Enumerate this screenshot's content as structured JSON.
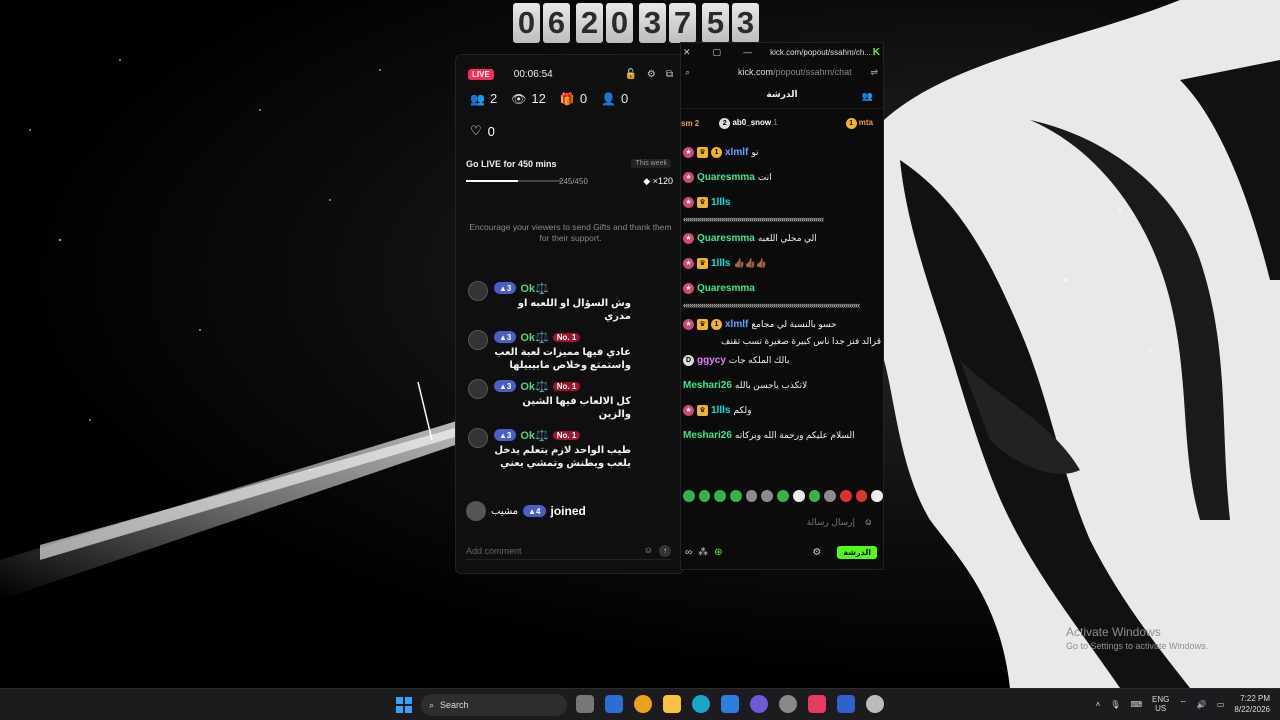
{
  "clock": {
    "digits": [
      "0",
      "6",
      "2",
      "0",
      "3",
      "7",
      "5",
      "3"
    ]
  },
  "dashboard": {
    "live_label": "LIVE",
    "duration": "00:06:54",
    "stats": {
      "viewers_now": "2",
      "views": "12",
      "gifts": "0",
      "new_followers": "0",
      "likes": "0"
    },
    "goal": {
      "title": "Go LIVE for 450 mins",
      "progress_text": "245/450",
      "progress_fraction": 0.544,
      "period": "This week",
      "reward": "×120"
    },
    "encourage_text": "Encourage your viewers to send Gifts and thank them for their support.",
    "messages": [
      {
        "level": "3",
        "user": "Ok⚖️",
        "badge": "",
        "text": "وش السؤال او اللعبه او مدري"
      },
      {
        "level": "3",
        "user": "Ok⚖️",
        "badge": "No. 1",
        "text": "عادي فيها مميزات لعبة العب واستمتع وخلاص مابيبيلها"
      },
      {
        "level": "3",
        "user": "Ok⚖️",
        "badge": "No. 1",
        "text": "كل الالعاب فيها الشين والزين"
      },
      {
        "level": "3",
        "user": "Ok⚖️",
        "badge": "No. 1",
        "text": "طيب الواحد لازم يتعلم يدخل يلعب ويطنش وتمشي يعني"
      }
    ],
    "joined": {
      "user": "مشيب",
      "level": "4",
      "word": "joined"
    },
    "comment_placeholder": "Add comment"
  },
  "kick": {
    "window_url": "kick.com/popout/ssahm/ch...",
    "address_domain": "kick.com",
    "address_path": "/popout/ssahm/chat",
    "header_title": "الدرشة",
    "pinned": {
      "left": "sm 2",
      "middle_user": "ab0_snow",
      "middle_count": "1",
      "right": "mta"
    },
    "messages": [
      {
        "user": "xlmlf",
        "color": "blue",
        "text": "تو",
        "extra": ""
      },
      {
        "user": "Quaresmma",
        "color": "green",
        "text": "انت",
        "extra": ""
      },
      {
        "user": "1llls",
        "color": "cyan",
        "text": "",
        "extra": "«««««««««««««««««««««««««««««««««««"
      },
      {
        "user": "Quaresmma",
        "color": "green",
        "text": "الي محلي اللعبه",
        "extra": ""
      },
      {
        "user": "1llls",
        "color": "cyan",
        "text": "👍🏾👍🏾👍🏾",
        "extra": ""
      },
      {
        "user": "Quaresmma",
        "color": "green",
        "text": "",
        "extra": "««««««««««««««««««««««««««««««««««««««««««««"
      },
      {
        "user": "xlmlf",
        "color": "blue",
        "text": "حسو بالنسبة لي مجامع",
        "extra": "قرالد فنز جدا ناس كبيرة صغيرة تسب تقنف"
      },
      {
        "user": "ggycy",
        "color": "pink2",
        "text": "بالك الملكه جات",
        "extra": ""
      },
      {
        "user": "Meshari26",
        "color": "green",
        "text": "لاتكذب ياحسن بالله",
        "extra": ""
      },
      {
        "user": "1llls",
        "color": "cyan",
        "text": "ولكم",
        "extra": ""
      },
      {
        "user": "Meshari26",
        "color": "green",
        "text": "السلام عليكم ورحمة الله وبركاته",
        "extra": ""
      }
    ],
    "input_placeholder": "إرسال رسالة",
    "send_label": "الدرشة"
  },
  "watermark": {
    "title": "Activate Windows",
    "subtitle": "Go to Settings to activate Windows."
  },
  "taskbar": {
    "search_label": "Search",
    "lang_top": "ENG",
    "lang_bottom": "US",
    "time": "7:22 PM",
    "date": "8/22/2026"
  },
  "colors": {
    "kick_green": "#53fc18",
    "live_red": "#ff2d55",
    "level_blue": "#4a5ec9"
  }
}
